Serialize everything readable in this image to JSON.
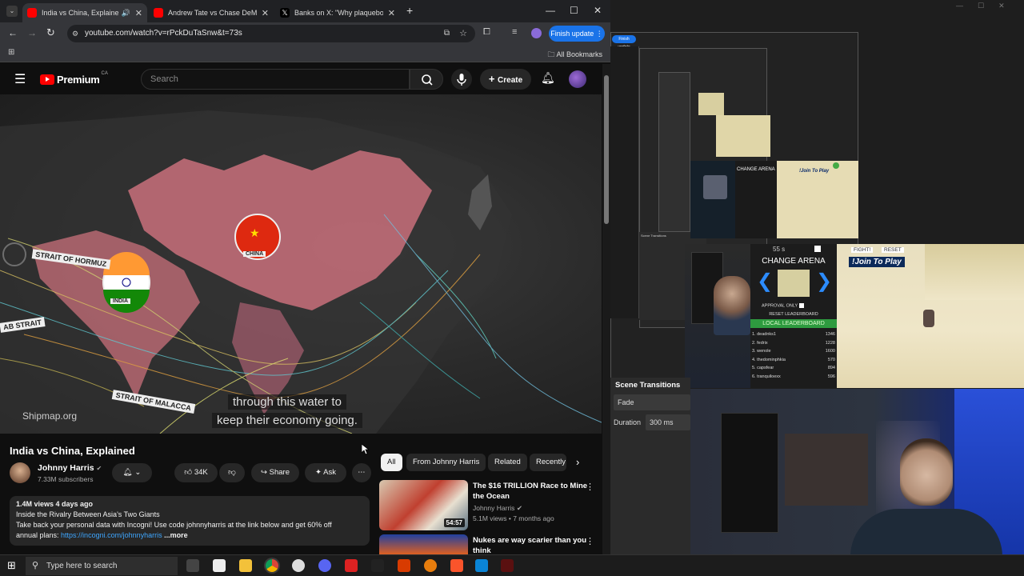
{
  "browser": {
    "tabs": [
      {
        "title": "India vs China, Explained - Y",
        "active": true
      },
      {
        "title": "Andrew Tate vs Chase DeMoor",
        "active": false
      },
      {
        "title": "Banks on X: \"Why plaqueboym",
        "active": false
      }
    ],
    "url": "youtube.com/watch?v=rPckDuTaSnw&t=73s",
    "finish_update": "Finish update",
    "all_bookmarks": "All Bookmarks"
  },
  "youtube": {
    "logo_text": "Premium",
    "logo_region": "CA",
    "search_placeholder": "Search",
    "create_label": "Create",
    "video": {
      "title": "India vs China, Explained",
      "watermark": "Shipmap.org",
      "caption_line1": "through this water to",
      "caption_line2": "keep their economy going.",
      "labels": {
        "hormuz": "STRAIT OF HORMUZ",
        "malacca": "STRAIT OF MALACCA",
        "bab": "AB STRAIT",
        "china": "CHINA",
        "india": "INDIA"
      }
    },
    "channel": {
      "name": "Johnny Harris",
      "subscribers": "7.33M subscribers"
    },
    "actions": {
      "likes": "34K",
      "share": "Share",
      "ask": "Ask"
    },
    "description": {
      "stats": "1.4M views  4 days ago",
      "line1": "Inside the Rivalry Between Asia's Two Giants",
      "line2": "Take back your personal data with Incogni! Use code johnnyharris at the link below and get 60% off",
      "line3_text": "annual plans: ",
      "link": "https://incogni.com/johnnyharris",
      "more": "...more"
    },
    "chips": [
      "All",
      "From Johnny Harris",
      "Related",
      "Recently"
    ],
    "recommendations": [
      {
        "title_line1": "The $16 TRILLION Race to Mine",
        "title_line2": "the Ocean",
        "channel": "Johnny Harris",
        "meta": "5.1M views • 7 months ago",
        "duration": "54:57"
      },
      {
        "title_line1": "Nukes are way scarier than you",
        "title_line2": "think"
      }
    ]
  },
  "obs": {
    "finish_update": "Finish update",
    "scene_transitions_title": "Scene Transitions",
    "transition": "Fade",
    "duration_label": "Duration",
    "duration_value": "300 ms",
    "game": {
      "timer": "55 s",
      "fight": "FIGHT!",
      "reset": "RESET",
      "change_arena": "CHANGE ARENA",
      "join": "!Join To Play",
      "approval_only": "APPROVAL ONLY",
      "reset_leaderboard": "RESET LEADERBOARD",
      "local_leaderboard": "LOCAL LEADERBOARD",
      "leaderboard": [
        {
          "rank": "1.",
          "name": "dead​nks1",
          "score": "1346"
        },
        {
          "rank": "2.",
          "name": "fedrix",
          "score": "1228"
        },
        {
          "rank": "3.",
          "name": "wenole",
          "score": "1600"
        },
        {
          "rank": "4.",
          "name": "thedominphkia",
          "score": "570"
        },
        {
          "rank": "5.",
          "name": "capsfear",
          "score": "894"
        },
        {
          "rank": "6.",
          "name": "tranquiloexx",
          "score": "596"
        }
      ]
    }
  },
  "taskbar": {
    "search_placeholder": "Type here to search"
  },
  "colors": {
    "youtube_red": "#ff0000",
    "finish_update_blue": "#1a73e8",
    "leaderboard_green": "#2e9b3f",
    "arena_arrow_blue": "#2c8cff"
  }
}
